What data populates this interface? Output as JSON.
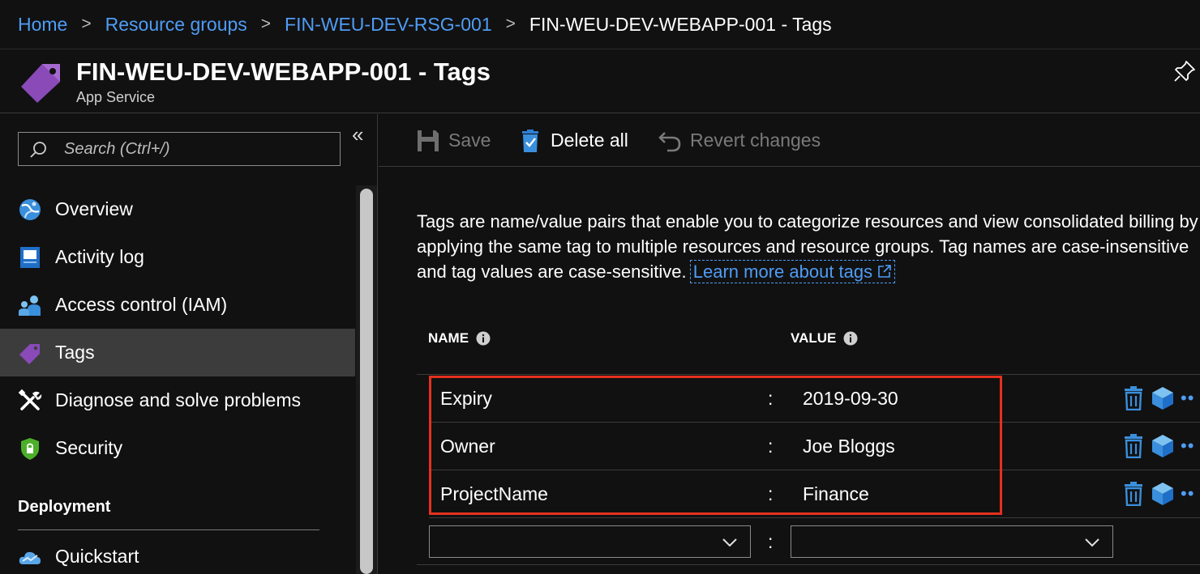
{
  "breadcrumb": {
    "items": [
      "Home",
      "Resource groups",
      "FIN-WEU-DEV-RSG-001"
    ],
    "current": "FIN-WEU-DEV-WEBAPP-001 - Tags",
    "separator": ">"
  },
  "header": {
    "title": "FIN-WEU-DEV-WEBAPP-001 - Tags",
    "subtitle": "App Service"
  },
  "sidebar": {
    "search_placeholder": "Search (Ctrl+/)",
    "collapse_label": "«",
    "items": [
      {
        "label": "Overview",
        "icon": "globe-icon"
      },
      {
        "label": "Activity log",
        "icon": "activity-log-icon"
      },
      {
        "label": "Access control (IAM)",
        "icon": "users-icon"
      },
      {
        "label": "Tags",
        "icon": "tag-icon",
        "active": true
      },
      {
        "label": "Diagnose and solve problems",
        "icon": "wrench-icon"
      },
      {
        "label": "Security",
        "icon": "shield-icon"
      }
    ],
    "section_header": "Deployment",
    "section_items": [
      {
        "label": "Quickstart",
        "icon": "cloud-icon"
      }
    ]
  },
  "toolbar": {
    "save_label": "Save",
    "delete_all_label": "Delete all",
    "revert_label": "Revert changes"
  },
  "content": {
    "description": "Tags are name/value pairs that enable you to categorize resources and view consolidated billing by applying the same tag to multiple resources and resource groups. Tag names are case-insensitive and tag values are case-sensitive.",
    "learn_more": "Learn more about tags"
  },
  "table": {
    "name_header": "NAME",
    "value_header": "VALUE",
    "separator": ":",
    "rows": [
      {
        "name": "Expiry",
        "value": "2019-09-30"
      },
      {
        "name": "Owner",
        "value": "Joe Bloggs"
      },
      {
        "name": "ProjectName",
        "value": "Finance"
      }
    ],
    "more_label": "••"
  },
  "colors": {
    "accent": "#4f9cf5",
    "highlight": "#e5301f",
    "tag_purple": "#8a4ab8",
    "background": "#111111"
  }
}
